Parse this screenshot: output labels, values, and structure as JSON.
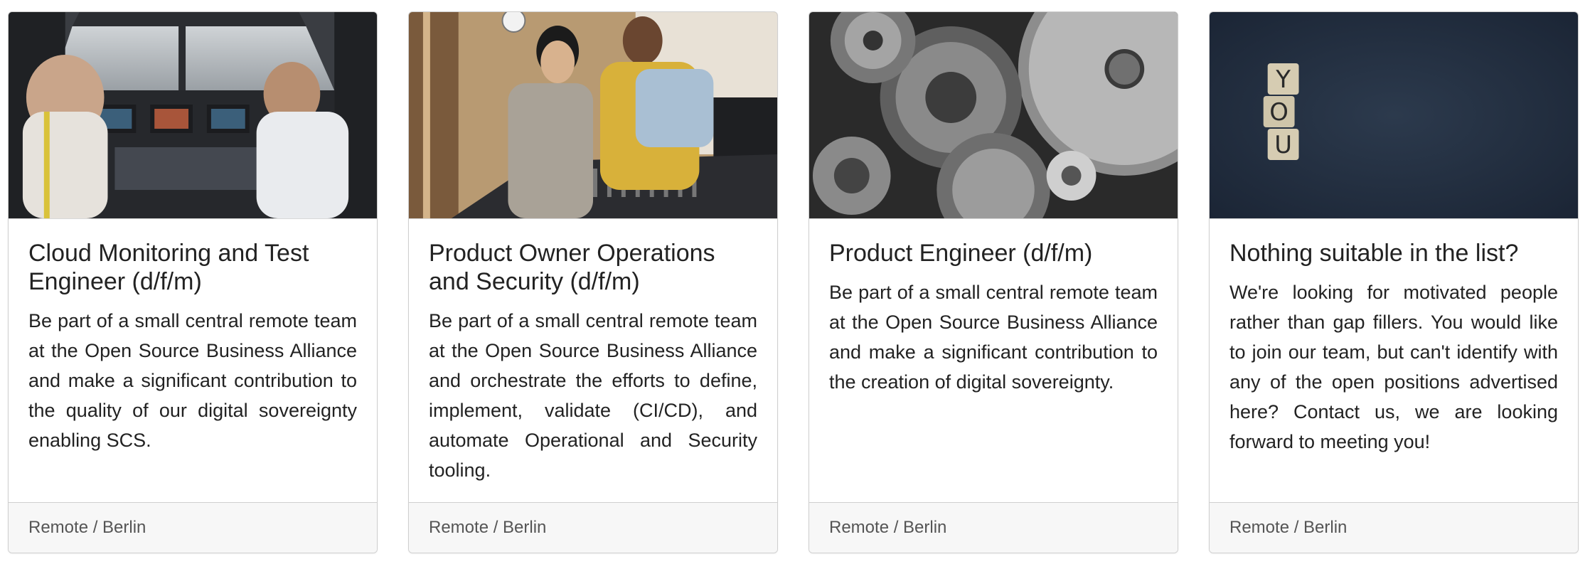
{
  "cards": [
    {
      "image": "cockpit-photo",
      "title": "Cloud Monitoring and Test Engineer (d/f/m)",
      "text": "Be part of a small central remote team at the Open Source Business Alliance and make a significant contribution to the quality of our digital sovereignty enabling SCS.",
      "footer": "Remote / Berlin"
    },
    {
      "image": "recording-studio-photo",
      "title": "Product Owner Operations and Security (d/f/m)",
      "text": "Be part of a small central remote team at the Open Source Business Alliance and orchestrate the efforts to define, implement, validate (CI/CD), and automate Operational and Security tooling.",
      "footer": "Remote / Berlin"
    },
    {
      "image": "gears-photo",
      "title": "Product Engineer (d/f/m)",
      "text": "Be part of a small central remote team at the Open Source Business Alliance and make a significant contribution to the creation of digital sovereignty.",
      "footer": "Remote / Berlin"
    },
    {
      "image": "you-letter-tiles-photo",
      "title": "Nothing suitable in the list?",
      "text": "We're looking for motivated people rather than gap fillers. You would like to join our team, but can't identify with any of the open positions advertised here? Contact us, we are looking forward to meeting you!",
      "footer": "Remote / Berlin",
      "tiles": [
        "Y",
        "O",
        "U"
      ]
    }
  ]
}
